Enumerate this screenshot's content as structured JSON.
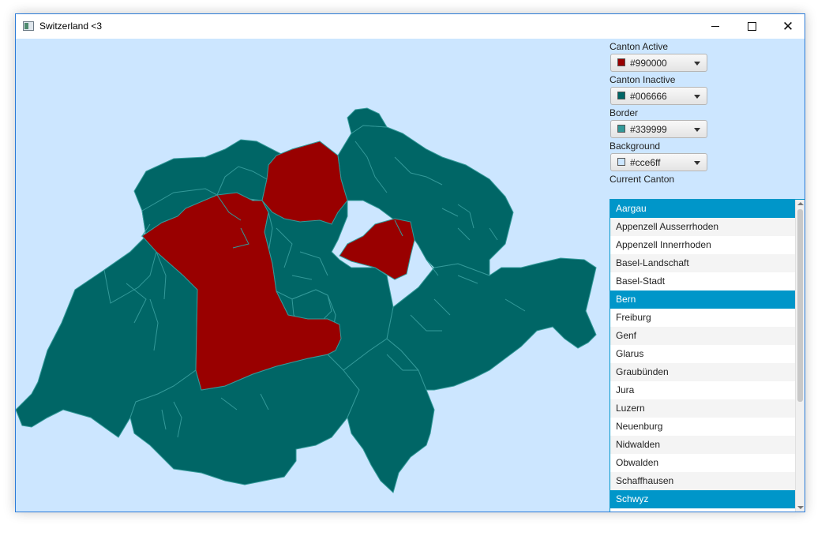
{
  "window": {
    "title": "Switzerland <3"
  },
  "colors": {
    "canton_active": "#990000",
    "canton_inactive": "#006666",
    "border": "#339999",
    "background": "#cce6ff",
    "selection": "#0096c9"
  },
  "controls": {
    "canton_active": {
      "label": "Canton Active",
      "value": "#990000"
    },
    "canton_inactive": {
      "label": "Canton Inactive",
      "value": "#006666"
    },
    "border": {
      "label": "Border",
      "value": "#339999"
    },
    "background": {
      "label": "Background",
      "value": "#cce6ff"
    }
  },
  "current_canton": {
    "label": "Current Canton",
    "items": [
      {
        "label": "Aargau",
        "selected": true
      },
      {
        "label": "Appenzell Ausserrhoden",
        "selected": false
      },
      {
        "label": "Appenzell Innerrhoden",
        "selected": false
      },
      {
        "label": "Basel-Landschaft",
        "selected": false
      },
      {
        "label": "Basel-Stadt",
        "selected": false
      },
      {
        "label": "Bern",
        "selected": true
      },
      {
        "label": "Freiburg",
        "selected": false
      },
      {
        "label": "Genf",
        "selected": false
      },
      {
        "label": "Glarus",
        "selected": false
      },
      {
        "label": "Graubünden",
        "selected": false
      },
      {
        "label": "Jura",
        "selected": false
      },
      {
        "label": "Luzern",
        "selected": false
      },
      {
        "label": "Neuenburg",
        "selected": false
      },
      {
        "label": "Nidwalden",
        "selected": false
      },
      {
        "label": "Obwalden",
        "selected": false
      },
      {
        "label": "Schaffhausen",
        "selected": false
      },
      {
        "label": "Schwyz",
        "selected": true
      }
    ]
  }
}
